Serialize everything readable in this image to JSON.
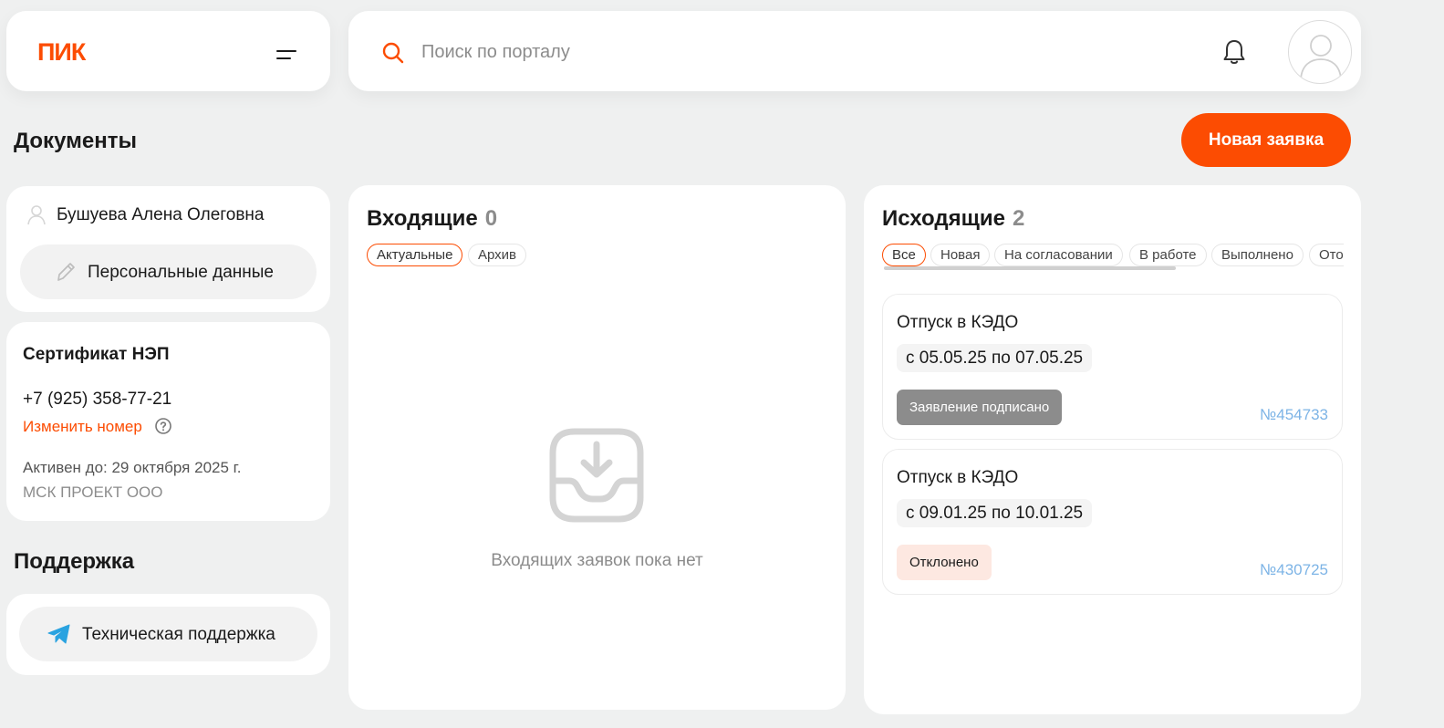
{
  "header": {
    "logo": "ПИК",
    "search_placeholder": "Поиск по порталу",
    "icons": {
      "menu": "hamburger-menu-icon",
      "search": "search-icon",
      "notifications": "bell-icon",
      "avatar": "user-avatar-icon"
    }
  },
  "page": {
    "title": "Документы",
    "new_request_label": "Новая заявка"
  },
  "user": {
    "name": "Бушуева Алена Олеговна",
    "personal_data_label": "Персональные данные"
  },
  "certificate": {
    "title": "Сертификат НЭП",
    "phone": "+7 (925) 358-77-21",
    "change_label": "Изменить номер",
    "active_until": "Активен до: 29 октября 2025 г.",
    "organization": "МСК ПРОЕКТ ООО"
  },
  "support": {
    "title": "Поддержка",
    "tech_support_label": "Техническая поддержка"
  },
  "incoming": {
    "title": "Входящие",
    "count": "0",
    "tabs": [
      "Актуальные",
      "Архив"
    ],
    "empty_text": "Входящих заявок пока нет"
  },
  "outgoing": {
    "title": "Исходящие",
    "count": "2",
    "filters": [
      "Все",
      "Новая",
      "На согласовании",
      "В работе",
      "Выполнено",
      "Отозвано"
    ],
    "requests": [
      {
        "title": "Отпуск в КЭДО",
        "dates": "с 05.05.25 по 07.05.25",
        "status": "Заявление подписано",
        "number": "№454733"
      },
      {
        "title": "Отпуск в КЭДО",
        "dates": "с 09.01.25 по 10.01.25",
        "status": "Отклонено",
        "number": "№430725"
      }
    ]
  },
  "colors": {
    "accent": "#fc4c02",
    "link_number": "#7db4e6",
    "status_signed": "#8c8c8c",
    "status_rejected": "#fde8e1"
  }
}
